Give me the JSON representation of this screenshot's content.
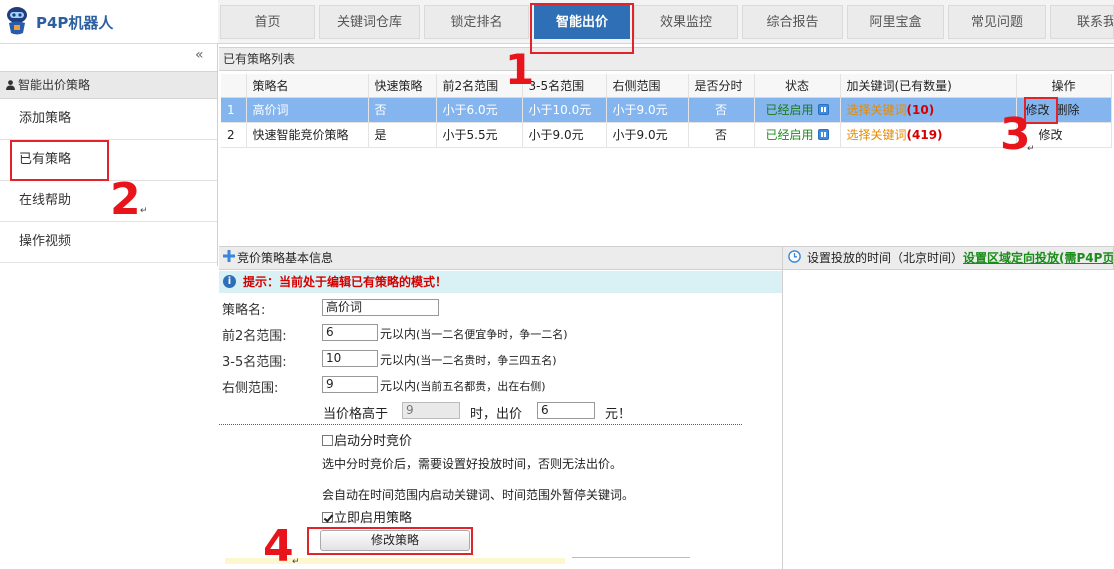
{
  "app": {
    "brand": "P4P机器人"
  },
  "nav": {
    "tabs": [
      {
        "label": "首页"
      },
      {
        "label": "关键词仓库"
      },
      {
        "label": "锁定排名"
      },
      {
        "label": "智能出价",
        "active": true
      },
      {
        "label": "效果监控"
      },
      {
        "label": "综合报告"
      },
      {
        "label": "阿里宝盒"
      },
      {
        "label": "常见问题"
      },
      {
        "label": "联系我"
      }
    ]
  },
  "sidebar": {
    "collapse": "«",
    "section": "智能出价策略",
    "items": [
      {
        "label": "添加策略"
      },
      {
        "label": "已有策略"
      },
      {
        "label": "在线帮助"
      },
      {
        "label": "操作视频"
      }
    ]
  },
  "strategyList": {
    "title": "已有策略列表",
    "columns": [
      "",
      "策略名",
      "快速策略",
      "前2名范围",
      "3-5名范围",
      "右侧范围",
      "是否分时",
      "状态",
      "加关键词(已有数量)",
      "操作"
    ],
    "rows": [
      {
        "index": "1",
        "name": "高价词",
        "fast": "否",
        "top2": "小于6.0元",
        "top35": "小于10.0元",
        "right": "小于9.0元",
        "timeshare": "否",
        "status": "已经启用",
        "kwText": "选择关键词",
        "kwCount": "(10)",
        "edit": "修改",
        "delete": "删除"
      },
      {
        "index": "2",
        "name": "快速智能竞价策略",
        "fast": "是",
        "top2": "小于5.5元",
        "top35": "小于9.0元",
        "right": "小于9.0元",
        "timeshare": "否",
        "status": "已经启用",
        "kwText": "选择关键词",
        "kwCount": "(419)",
        "edit": "修改",
        "delete": ""
      }
    ]
  },
  "editPanel": {
    "title": "竞价策略基本信息",
    "tip": "提示：当前处于编辑已有策略的模式！",
    "nameLabel": "策略名:",
    "nameValue": "高价词",
    "top2Label": "前2名范围:",
    "top2Value": "6",
    "top2Suffix": "元以内",
    "top2Note": "(当一二名便宜争时，争一二名)",
    "top35Label": "3-5名范围:",
    "top35Value": "10",
    "top35Suffix": "元以内",
    "top35Note": "(当一二名贵时，争三四五名)",
    "rightLabel": "右侧范围:",
    "rightValue": "9",
    "rightSuffix": "元以内",
    "rightNote": "(当前五名都贵，出在右侧)",
    "condPrefix": "当价格高于",
    "condValue": "9",
    "condMid": "时，出价",
    "condBid": "6",
    "condSuffix": "元！",
    "timeshareLabel": "启动分时竞价",
    "note1": "选中分时竞价后，需要设置好投放时间，否则无法出价。",
    "note2": "会自动在时间范围内启动关键词、时间范围外暂停关键词。",
    "enableLabel": "立即启用策略",
    "saveButton": "修改策略"
  },
  "schedulePanel": {
    "title": "设置投放的时间（北京时间）",
    "link": "设置区域定向投放(需P4P页"
  },
  "annotations": [
    "1",
    "2",
    "3",
    "4"
  ],
  "colors": {
    "accent": "#2f6fb6",
    "selectedRow": "#85b5ee",
    "annotation": "#e0242a",
    "enabled": "#1e8c1e",
    "keyword": "#e58a00"
  }
}
